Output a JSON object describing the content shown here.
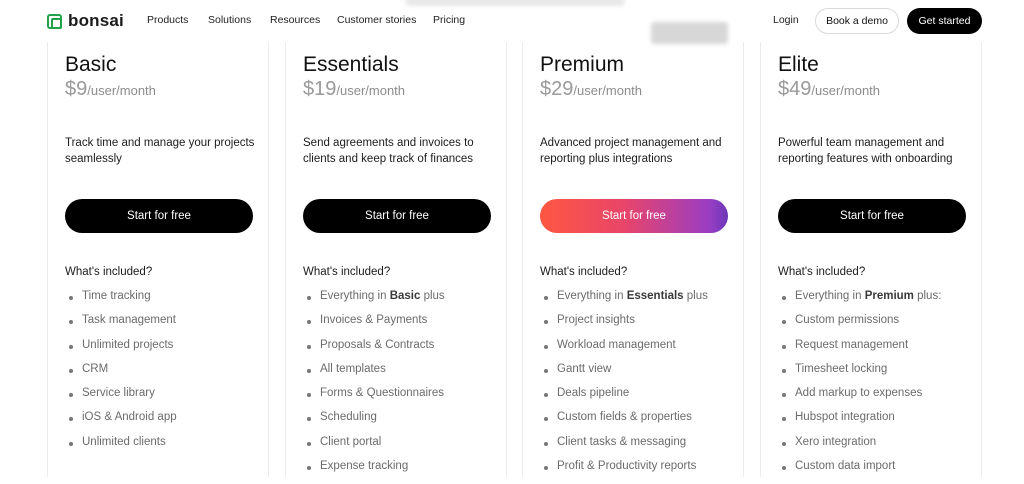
{
  "nav": {
    "brand": "bonsai",
    "links": [
      "Products",
      "Solutions",
      "Resources",
      "Customer stories",
      "Pricing"
    ],
    "login": "Login",
    "book_demo": "Book a demo",
    "get_started": "Get started"
  },
  "plans": [
    {
      "name": "Basic",
      "price": "$9",
      "unit": "/user/month",
      "description": "Track time and manage your projects seamlessly",
      "cta": "Start for free",
      "included_title": "What's included?",
      "features": [
        {
          "pre": "Time tracking",
          "bold": "",
          "post": ""
        },
        {
          "pre": "Task management",
          "bold": "",
          "post": ""
        },
        {
          "pre": "Unlimited projects",
          "bold": "",
          "post": ""
        },
        {
          "pre": "CRM",
          "bold": "",
          "post": ""
        },
        {
          "pre": "Service library",
          "bold": "",
          "post": ""
        },
        {
          "pre": "iOS & Android app",
          "bold": "",
          "post": ""
        },
        {
          "pre": "Unlimited clients",
          "bold": "",
          "post": ""
        }
      ]
    },
    {
      "name": "Essentials",
      "price": "$19",
      "unit": "/user/month",
      "description": "Send agreements and invoices to clients and keep track of finances",
      "cta": "Start for free",
      "included_title": "What's included?",
      "features": [
        {
          "pre": "Everything in ",
          "bold": "Basic",
          "post": " plus"
        },
        {
          "pre": "Invoices & Payments",
          "bold": "",
          "post": ""
        },
        {
          "pre": "Proposals & Contracts",
          "bold": "",
          "post": ""
        },
        {
          "pre": "All templates",
          "bold": "",
          "post": ""
        },
        {
          "pre": "Forms & Questionnaires",
          "bold": "",
          "post": ""
        },
        {
          "pre": "Scheduling",
          "bold": "",
          "post": ""
        },
        {
          "pre": "Client portal",
          "bold": "",
          "post": ""
        },
        {
          "pre": "Expense tracking",
          "bold": "",
          "post": ""
        }
      ]
    },
    {
      "name": "Premium",
      "price": "$29",
      "unit": "/user/month",
      "description": "Advanced project management and reporting plus integrations",
      "cta": "Start for free",
      "included_title": "What's included?",
      "features": [
        {
          "pre": "Everything in ",
          "bold": "Essentials",
          "post": " plus"
        },
        {
          "pre": "Project insights",
          "bold": "",
          "post": ""
        },
        {
          "pre": "Workload management",
          "bold": "",
          "post": ""
        },
        {
          "pre": "Gantt view",
          "bold": "",
          "post": ""
        },
        {
          "pre": "Deals pipeline",
          "bold": "",
          "post": ""
        },
        {
          "pre": "Custom fields & properties",
          "bold": "",
          "post": ""
        },
        {
          "pre": "Client tasks & messaging",
          "bold": "",
          "post": ""
        },
        {
          "pre": "Profit & Productivity reports",
          "bold": "",
          "post": ""
        }
      ]
    },
    {
      "name": "Elite",
      "price": "$49",
      "unit": "/user/month",
      "description": "Powerful team management and reporting features with onboarding",
      "cta": "Start for free",
      "included_title": "What's included?",
      "features": [
        {
          "pre": "Everything in ",
          "bold": "Premium",
          "post": " plus:"
        },
        {
          "pre": "Custom permissions",
          "bold": "",
          "post": ""
        },
        {
          "pre": "Request management",
          "bold": "",
          "post": ""
        },
        {
          "pre": "Timesheet locking",
          "bold": "",
          "post": ""
        },
        {
          "pre": "Add markup to expenses",
          "bold": "",
          "post": ""
        },
        {
          "pre": "Hubspot integration",
          "bold": "",
          "post": ""
        },
        {
          "pre": "Xero integration",
          "bold": "",
          "post": ""
        },
        {
          "pre": "Custom data import",
          "bold": "",
          "post": ""
        }
      ]
    }
  ],
  "colors": {
    "brand_green": "#22a34a",
    "premium_gradient_start": "#ff5742",
    "premium_gradient_end": "#6b39b8"
  }
}
